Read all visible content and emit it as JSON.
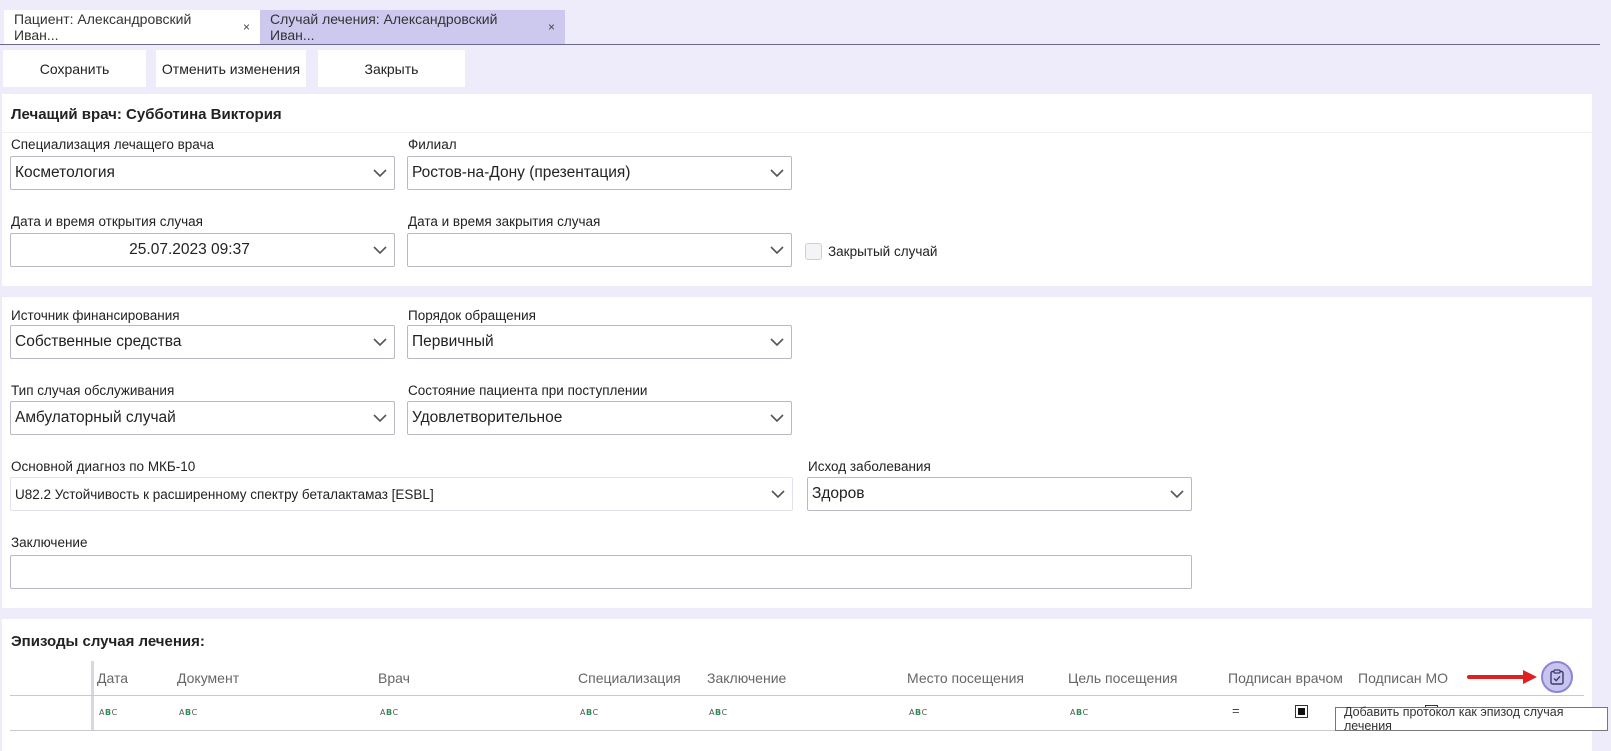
{
  "tabs": [
    {
      "label": "Пациент: Александровский Иван...",
      "close": "×"
    },
    {
      "label": "Случай лечения: Александровский Иван...",
      "close": "×"
    }
  ],
  "toolbar": {
    "save": "Сохранить",
    "cancel": "Отменить изменения",
    "close": "Закрыть"
  },
  "doctor_section": {
    "title": "Лечащий врач: Субботина Виктория",
    "specialization_label": "Специализация лечащего врача",
    "specialization_value": "Косметология",
    "branch_label": "Филиал",
    "branch_value": "Ростов-на-Дону (презентация)",
    "open_dt_label": "Дата и время открытия случая",
    "open_dt_value": "25.07.2023 09:37",
    "close_dt_label": "Дата и время закрытия случая",
    "close_dt_value": "",
    "closed_case_label": "Закрытый случай"
  },
  "case_section": {
    "funding_label": "Источник финансирования",
    "funding_value": "Собственные средства",
    "order_label": "Порядок обращения",
    "order_value": "Первичный",
    "service_type_label": "Тип случая обслуживания",
    "service_type_value": "Амбулаторный случай",
    "state_label": "Состояние пациента при поступлении",
    "state_value": "Удовлетворительное",
    "diagnosis_label": "Основной диагноз по МКБ-10",
    "diagnosis_value": "U82.2 Устойчивость к расширенному спектру беталактамаз [ESBL]",
    "outcome_label": "Исход заболевания",
    "outcome_value": "Здоров",
    "conclusion_label": "Заключение",
    "conclusion_value": ""
  },
  "episodes": {
    "title": "Эпизоды случая лечения:",
    "columns": [
      "Дата",
      "Документ",
      "Врач",
      "Специализация",
      "Заключение",
      "Место посещения",
      "Цель посещения",
      "Подписан врачом",
      "Подписан МО"
    ],
    "filter_glyph_left": "A",
    "filter_glyph_mid": "B",
    "filter_glyph_right": "C",
    "equals_glyph": "="
  },
  "tooltip": "Добавить протокол как эпизод случая лечения",
  "colors": {
    "accent": "#cdc8ee",
    "background": "#eeecfb",
    "arrow": "#e02020",
    "button": "#c8c3ef"
  }
}
